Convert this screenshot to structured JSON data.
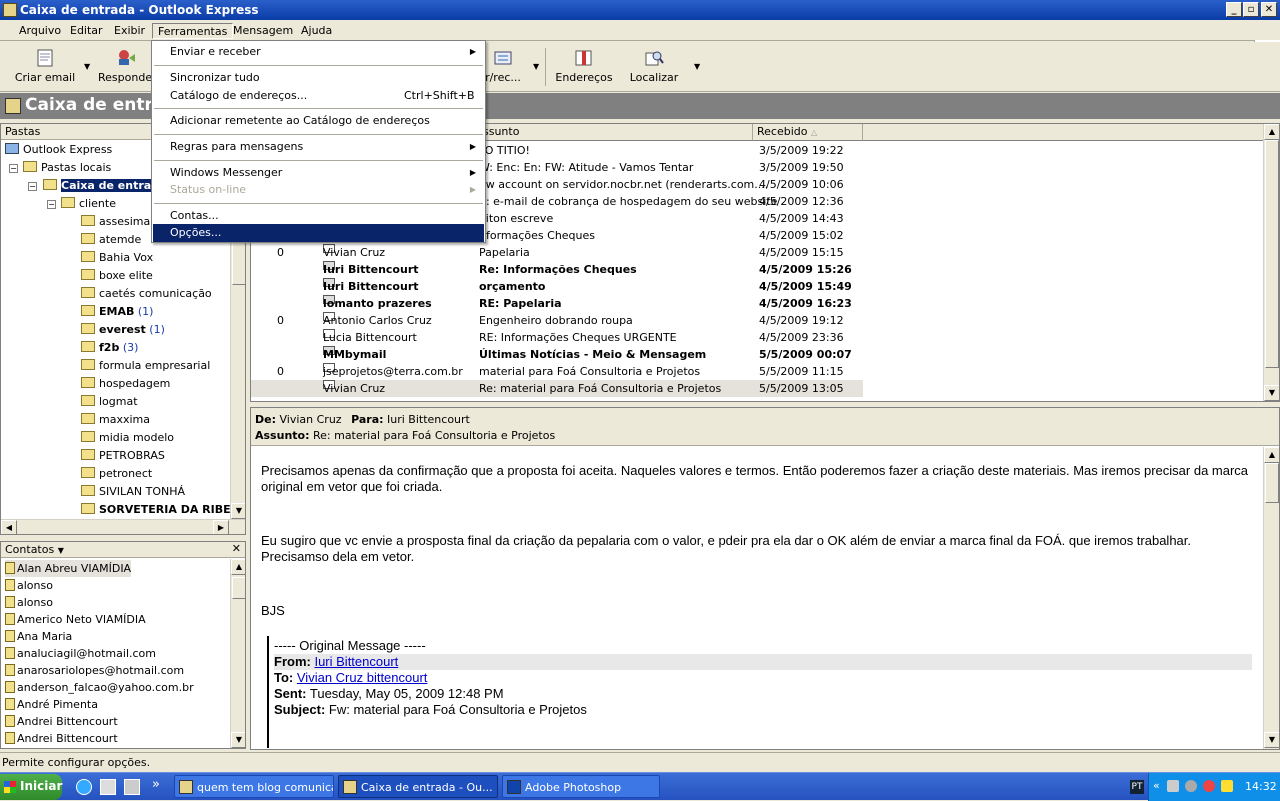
{
  "window": {
    "title": "Caixa de entrada - Outlook Express"
  },
  "menubar": [
    "Arquivo",
    "Editar",
    "Exibir",
    "Ferramentas",
    "Mensagem",
    "Ajuda"
  ],
  "toolbar": {
    "create": "Criar email",
    "reply": "Responder",
    "sendrecv": "r/rec...",
    "addresses": "Endereços",
    "find": "Localizar"
  },
  "header": {
    "title": "Caixa de entrada"
  },
  "folders": {
    "header": "Pastas",
    "root": "Outlook Express",
    "local": "Pastas locais",
    "inbox": "Caixa de entrada",
    "cliente": "cliente",
    "items": [
      {
        "name": "assesima",
        "count": "",
        "bold": false
      },
      {
        "name": "atemde",
        "count": "",
        "bold": false
      },
      {
        "name": "Bahia Vox",
        "count": "",
        "bold": false
      },
      {
        "name": "boxe elite",
        "count": "",
        "bold": false
      },
      {
        "name": "caetés comunicação",
        "count": "",
        "bold": false
      },
      {
        "name": "EMAB",
        "count": "(1)",
        "bold": true
      },
      {
        "name": "everest",
        "count": "(1)",
        "bold": true
      },
      {
        "name": "f2b",
        "count": "(3)",
        "bold": true
      },
      {
        "name": "formula empresarial",
        "count": "",
        "bold": false
      },
      {
        "name": "hospedagem",
        "count": "",
        "bold": false
      },
      {
        "name": "logmat",
        "count": "",
        "bold": false
      },
      {
        "name": "maxxima",
        "count": "",
        "bold": false
      },
      {
        "name": "midia modelo",
        "count": "",
        "bold": false
      },
      {
        "name": "PETROBRAS",
        "count": "",
        "bold": false
      },
      {
        "name": "petronect",
        "count": "",
        "bold": false
      },
      {
        "name": "SIVILAN TONHÁ",
        "count": "",
        "bold": false
      },
      {
        "name": "SORVETERIA DA RIBEIR",
        "count": "",
        "bold": true
      }
    ]
  },
  "contacts": {
    "header": "Contatos",
    "items": [
      "Alan Abreu VIAMÍDIA",
      "alonso",
      "alonso",
      "Americo Neto VIAMÍDIA",
      "Ana Maria",
      "analuciagil@hotmail.com",
      "anarosariolopes@hotmail.com",
      "anderson_falcao@yahoo.com.br",
      "André Pimenta",
      "Andrei Bittencourt",
      "Andrei Bittencourt"
    ]
  },
  "messages": {
    "col_subject": "ssunto",
    "col_received": "Recebido",
    "rows": [
      {
        "clip": "",
        "from": "",
        "subject": "LO TITIO!",
        "date": "3/5/2009 19:22",
        "bold": false,
        "hl": false
      },
      {
        "clip": "",
        "from": "",
        "subject": "W: Enc: En: FW: Atitude - Vamos Tentar",
        "date": "3/5/2009 19:50",
        "bold": false,
        "hl": false
      },
      {
        "clip": "",
        "from": "",
        "subject": "ew account on servidor.nocbr.net (renderarts.com....",
        "date": "4/5/2009 10:06",
        "bold": false,
        "hl": false
      },
      {
        "clip": "",
        "from": "",
        "subject": "E: e-mail de cobrança de hospedagem do seu website",
        "date": "4/5/2009 12:36",
        "bold": false,
        "hl": false
      },
      {
        "clip": "",
        "from": "",
        "subject": "eiton escreve",
        "date": "4/5/2009 14:43",
        "bold": false,
        "hl": false
      },
      {
        "clip": "",
        "from": "",
        "subject": "nformações Cheques",
        "date": "4/5/2009 15:02",
        "bold": false,
        "hl": false
      },
      {
        "clip": "0",
        "from": "Vivian Cruz",
        "subject": "Papelaria",
        "date": "4/5/2009 15:15",
        "bold": false,
        "hl": false
      },
      {
        "clip": "",
        "from": "Iuri Bittencourt",
        "subject": "Re: Informações Cheques",
        "date": "4/5/2009 15:26",
        "bold": true,
        "hl": false
      },
      {
        "clip": "",
        "from": "Iuri Bittencourt",
        "subject": "orçamento",
        "date": "4/5/2009 15:49",
        "bold": true,
        "hl": false
      },
      {
        "clip": "",
        "from": "lomanto prazeres",
        "subject": "RE: Papelaria",
        "date": "4/5/2009 16:23",
        "bold": true,
        "hl": false
      },
      {
        "clip": "0",
        "from": "Antonio Carlos Cruz",
        "subject": "Engenheiro dobrando roupa",
        "date": "4/5/2009 19:12",
        "bold": false,
        "hl": false
      },
      {
        "clip": "",
        "from": "Lucia Bittencourt",
        "subject": "RE: Informações Cheques URGENTE",
        "date": "4/5/2009 23:36",
        "bold": false,
        "hl": false
      },
      {
        "clip": "",
        "from": "MMbymail",
        "subject": "Últimas Notícias - Meio & Mensagem",
        "date": "5/5/2009 00:07",
        "bold": true,
        "hl": false
      },
      {
        "clip": "0",
        "from": "jseprojetos@terra.com.br",
        "subject": "material  para Foá Consultoria e Projetos",
        "date": "5/5/2009 11:15",
        "bold": false,
        "hl": false
      },
      {
        "clip": "",
        "from": "Vivian Cruz",
        "subject": "Re: material  para Foá Consultoria e Projetos",
        "date": "5/5/2009 13:05",
        "bold": false,
        "hl": true
      }
    ]
  },
  "preview": {
    "de_label": "De:",
    "de": "Vivian Cruz",
    "para_label": "Para:",
    "para": "Iuri Bittencourt",
    "assunto_label": "Assunto:",
    "assunto": "Re: material  para Foá Consultoria e Projetos",
    "p1": "Precisamos apenas da confirmação que a proposta foi aceita. Naqueles valores e termos. Então poderemos fazer a criação deste materiais. Mas iremos precisar da marca original em vetor que foi criada.",
    "p2": "Eu sugiro que vc envie a prosposta final da criação da pepalaria com o valor, e pdeir pra ela dar o OK além de enviar a marca final da FOÁ. que iremos trabalhar. Precisamso dela em vetor.",
    "p3": "BJS",
    "orig": "----- Original Message -----",
    "from_label": "From:",
    "from": "Iuri Bittencourt",
    "to_label": "To:",
    "to": "Vivian Cruz bittencourt",
    "sent_label": "Sent:",
    "sent": "Tuesday, May 05, 2009 12:48 PM",
    "subject_label": "Subject:",
    "subject": "Fw: material para Foá Consultoria e Projetos"
  },
  "dropdown": {
    "items": [
      {
        "label": "Enviar e receber",
        "shortcut": "",
        "arrow": true,
        "disabled": false
      },
      {
        "label": "Sincronizar tudo",
        "shortcut": "",
        "arrow": false,
        "disabled": false
      },
      {
        "label": "Catálogo de endereços...",
        "shortcut": "Ctrl+Shift+B",
        "arrow": false,
        "disabled": false
      },
      {
        "label": "Adicionar remetente ao Catálogo de endereços",
        "shortcut": "",
        "arrow": false,
        "disabled": false
      },
      {
        "label": "Regras para mensagens",
        "shortcut": "",
        "arrow": true,
        "disabled": false
      },
      {
        "label": "Windows Messenger",
        "shortcut": "",
        "arrow": true,
        "disabled": false
      },
      {
        "label": "Status on-line",
        "shortcut": "",
        "arrow": true,
        "disabled": true
      },
      {
        "label": "Contas...",
        "shortcut": "",
        "arrow": false,
        "disabled": false
      },
      {
        "label": "Opções...",
        "shortcut": "",
        "arrow": false,
        "disabled": false
      }
    ]
  },
  "status": {
    "text": "Permite configurar opções."
  },
  "taskbar": {
    "start": "Iniciar",
    "chev": "»",
    "tasks": [
      "quem tem blog comunica ...",
      "Caixa de entrada - Ou...",
      "Adobe Photoshop"
    ],
    "lang": "PT",
    "tray_chev": "«",
    "clock": "14:32"
  }
}
